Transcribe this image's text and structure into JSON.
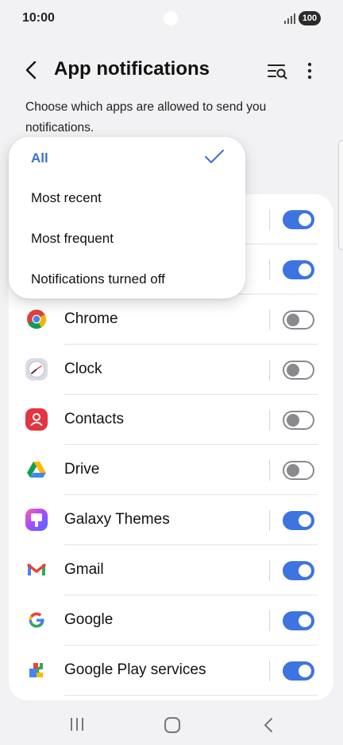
{
  "status_bar": {
    "time": "10:00",
    "battery": "100"
  },
  "header": {
    "title": "App notifications"
  },
  "description": "Choose which apps are allowed to send you notifications.",
  "dropdown": {
    "items": [
      {
        "label": "All",
        "selected": true
      },
      {
        "label": "Most recent",
        "selected": false
      },
      {
        "label": "Most frequent",
        "selected": false
      },
      {
        "label": "Notifications turned off",
        "selected": false
      }
    ]
  },
  "apps": [
    {
      "name": "",
      "enabled": true
    },
    {
      "name": "",
      "enabled": true
    },
    {
      "name": "Chrome",
      "icon": "chrome-icon",
      "enabled": false
    },
    {
      "name": "Clock",
      "icon": "clock-icon",
      "enabled": false
    },
    {
      "name": "Contacts",
      "icon": "contacts-icon",
      "enabled": false
    },
    {
      "name": "Drive",
      "icon": "drive-icon",
      "enabled": false
    },
    {
      "name": "Galaxy Themes",
      "icon": "galaxy-themes-icon",
      "enabled": true
    },
    {
      "name": "Gmail",
      "icon": "gmail-icon",
      "enabled": true
    },
    {
      "name": "Google",
      "icon": "google-icon",
      "enabled": true
    },
    {
      "name": "Google Play services",
      "icon": "google-play-services-icon",
      "enabled": true
    }
  ],
  "colors": {
    "accent": "#3d74e0",
    "toggle_off": "#8a8a8e",
    "background": "#f2f2f4"
  }
}
